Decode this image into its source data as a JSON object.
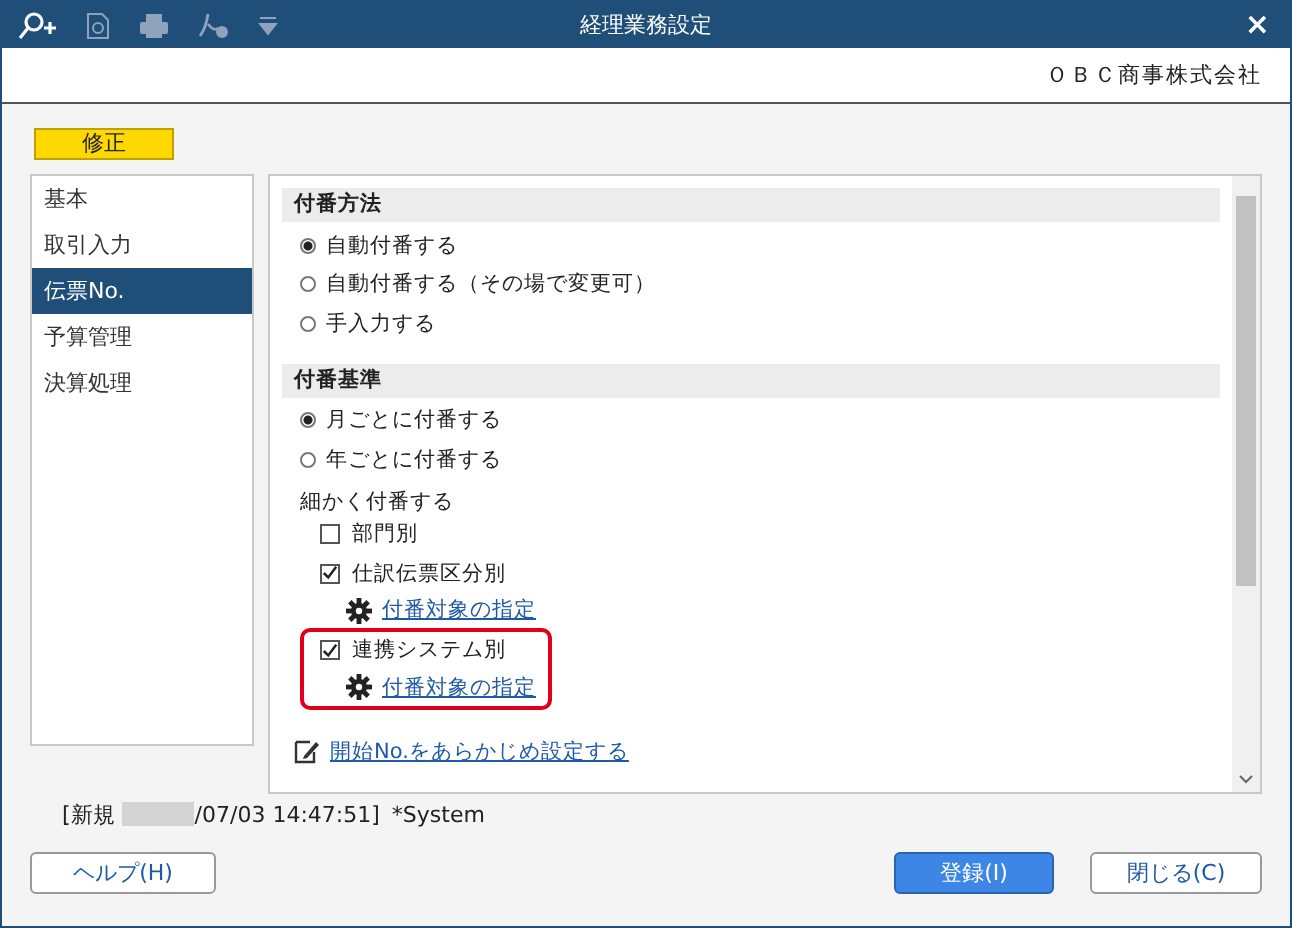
{
  "window": {
    "title": "経理業務設定",
    "close": "×"
  },
  "company": "ＯＢＣ商事株式会社",
  "mode_badge": "修正",
  "sidebar": {
    "items": [
      {
        "label": "基本",
        "selected": false
      },
      {
        "label": "取引入力",
        "selected": false
      },
      {
        "label": "伝票No.",
        "selected": true
      },
      {
        "label": "予算管理",
        "selected": false
      },
      {
        "label": "決算処理",
        "selected": false
      }
    ]
  },
  "sections": [
    {
      "title": "付番方法",
      "options": [
        {
          "label": "自動付番する",
          "selected": true
        },
        {
          "label": "自動付番する（その場で変更可）",
          "selected": false
        },
        {
          "label": "手入力する",
          "selected": false
        }
      ]
    },
    {
      "title": "付番基準",
      "options": [
        {
          "label": "月ごとに付番する",
          "selected": true
        },
        {
          "label": "年ごとに付番する",
          "selected": false
        }
      ],
      "detail": {
        "label": "細かく付番する",
        "checks": [
          {
            "label": "部門別",
            "checked": false,
            "highlighted": false
          },
          {
            "label": "仕訳伝票区分別",
            "checked": true,
            "highlighted": false,
            "link": "付番対象の指定"
          },
          {
            "label": "連携システム別",
            "checked": true,
            "highlighted": true,
            "link": "付番対象の指定"
          }
        ]
      }
    }
  ],
  "start_link": "開始No.をあらかじめ設定する",
  "status": {
    "prefix": "[新規",
    "time": "/07/03 14:47:51]",
    "user": "*System"
  },
  "buttons": [
    {
      "label": "ヘルプ(H)",
      "kind": "normal"
    },
    {
      "label": "登録(I)",
      "kind": "primary"
    },
    {
      "label": "閉じる(C)",
      "kind": "normal"
    }
  ]
}
